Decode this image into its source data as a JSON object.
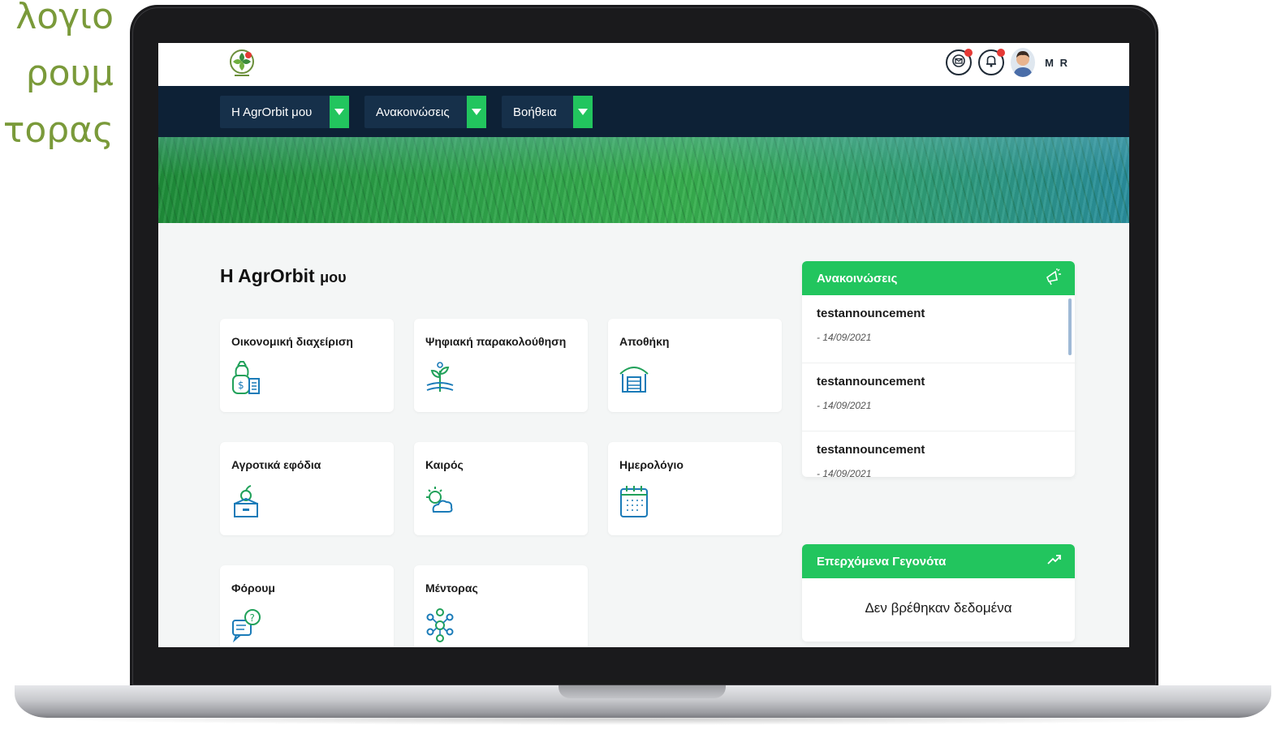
{
  "side_text": [
    "λογιο",
    "ρουμ",
    "τορας"
  ],
  "header": {
    "user_initials": "M R"
  },
  "nav": [
    {
      "label": "H AgrOrbit μου"
    },
    {
      "label": "Ανακοινώσεις"
    },
    {
      "label": "Βοήθεια"
    }
  ],
  "main": {
    "title_bold": "H AgrOrbit",
    "title_rest": "μου",
    "tiles": [
      {
        "label": "Οικονομική διαχείριση",
        "icon": "money-bag-icon"
      },
      {
        "label": "Ψηφιακή παρακολούθηση",
        "icon": "plant-monitoring-icon"
      },
      {
        "label": "Αποθήκη",
        "icon": "warehouse-icon"
      },
      {
        "label": "Αγροτικά εφόδια",
        "icon": "supplies-box-icon"
      },
      {
        "label": "Καιρός",
        "icon": "weather-icon"
      },
      {
        "label": "Ημερολόγιο",
        "icon": "calendar-icon"
      },
      {
        "label": "Φόρουμ",
        "icon": "forum-icon"
      },
      {
        "label": "Μέντορας",
        "icon": "mentor-icon"
      }
    ]
  },
  "announcements": {
    "title": "Ανακοινώσεις",
    "icon": "megaphone-icon",
    "items": [
      {
        "title": "testannouncement",
        "date": "- 14/09/2021"
      },
      {
        "title": "testannouncement",
        "date": "- 14/09/2021"
      },
      {
        "title": "testannouncement",
        "date": "- 14/09/2021"
      }
    ]
  },
  "events": {
    "title": "Επερχόμενα Γεγονότα",
    "icon": "trend-arrow-icon",
    "empty_text": "Δεν βρέθηκαν δεδομένα"
  },
  "colors": {
    "accent_green": "#22c55e",
    "nav_dark": "#0d2136",
    "side_text": "#7a9a3a"
  }
}
